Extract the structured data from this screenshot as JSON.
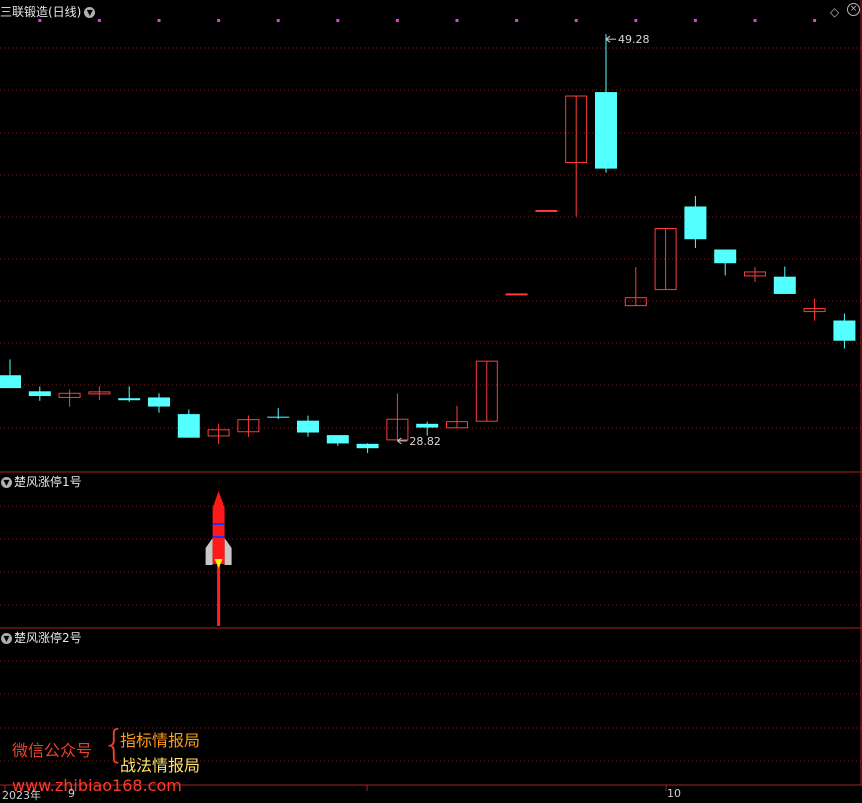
{
  "header": {
    "title": "三联锻造(日线)",
    "sub_panel_1_title": "楚风涨停1号",
    "sub_panel_2_title": "楚风涨停2号"
  },
  "colors": {
    "up": "#ff3c3c",
    "down": "#54ffff",
    "grid": "#8c1a1a",
    "marker": "#e040e0",
    "background": "#000000"
  },
  "icons": {
    "dropdown": "chevron-down-icon",
    "diamond": "diamond-icon",
    "close": "close-icon"
  },
  "chart_data": [
    {
      "type": "candlestick",
      "title": "三联锻造(日线)",
      "ylim": [
        27.2,
        50.6
      ],
      "grid": true,
      "annotations": [
        {
          "label": "49.28",
          "value": 49.28,
          "type": "high"
        },
        {
          "label": "28.82",
          "value": 28.82,
          "type": "low"
        }
      ],
      "candles": [
        {
          "open": 32.08,
          "close": 31.43,
          "high": 32.88,
          "low": 31.43
        },
        {
          "open": 31.27,
          "close": 31.03,
          "high": 31.51,
          "low": 30.79
        },
        {
          "open": 30.96,
          "close": 31.17,
          "high": 31.36,
          "low": 30.49
        },
        {
          "open": 31.14,
          "close": 31.24,
          "high": 31.52,
          "low": 30.83
        },
        {
          "open": 30.92,
          "close": 30.82,
          "high": 31.52,
          "low": 30.74
        },
        {
          "open": 30.96,
          "close": 30.5,
          "high": 31.17,
          "low": 30.19
        },
        {
          "open": 30.12,
          "close": 28.93,
          "high": 30.35,
          "low": 28.93
        },
        {
          "open": 29.02,
          "close": 29.33,
          "high": 29.64,
          "low": 28.61
        },
        {
          "open": 29.23,
          "close": 29.84,
          "high": 30.05,
          "low": 28.96
        },
        {
          "open": 29.99,
          "close": 29.96,
          "high": 30.42,
          "low": 29.87
        },
        {
          "open": 29.79,
          "close": 29.19,
          "high": 30.04,
          "low": 28.98
        },
        {
          "open": 29.06,
          "close": 28.64,
          "high": 29.07,
          "low": 28.52
        },
        {
          "open": 28.62,
          "close": 28.4,
          "high": 28.65,
          "low": 28.16
        },
        {
          "open": 28.82,
          "close": 29.86,
          "high": 31.16,
          "low": 28.82
        },
        {
          "open": 29.63,
          "close": 29.44,
          "high": 29.74,
          "low": 29.03
        },
        {
          "open": 29.43,
          "close": 29.74,
          "high": 30.55,
          "low": 29.43
        },
        {
          "open": 29.76,
          "close": 32.79,
          "high": 32.79,
          "low": 29.76
        },
        {
          "open": 36.18,
          "close": 36.18,
          "high": 36.18,
          "low": 36.18
        },
        {
          "open": 40.39,
          "close": 40.39,
          "high": 40.39,
          "low": 40.39
        },
        {
          "open": 42.81,
          "close": 46.16,
          "high": 46.16,
          "low": 40.09
        },
        {
          "open": 46.36,
          "close": 42.5,
          "high": 49.28,
          "low": 42.3
        },
        {
          "open": 35.59,
          "close": 35.99,
          "high": 37.53,
          "low": 35.59
        },
        {
          "open": 36.4,
          "close": 39.48,
          "high": 39.48,
          "low": 36.4
        },
        {
          "open": 40.59,
          "close": 38.94,
          "high": 41.12,
          "low": 38.5
        },
        {
          "open": 38.42,
          "close": 37.73,
          "high": 38.42,
          "low": 37.12
        },
        {
          "open": 37.09,
          "close": 37.29,
          "high": 37.54,
          "low": 36.78
        },
        {
          "open": 37.05,
          "close": 36.18,
          "high": 37.56,
          "low": 36.18
        },
        {
          "open": 35.29,
          "close": 35.45,
          "high": 35.95,
          "low": 34.83
        },
        {
          "open": 34.84,
          "close": 33.82,
          "high": 35.19,
          "low": 33.43
        }
      ]
    },
    {
      "type": "signal",
      "title": "楚风涨停1号",
      "signals": [
        {
          "bar_index": 7,
          "symbol": "rocket"
        }
      ]
    },
    {
      "type": "signal",
      "title": "楚风涨停2号",
      "signals": []
    }
  ],
  "xaxis": {
    "labels": [
      "2023年",
      "9",
      "10"
    ]
  },
  "watermark": {
    "wechat_label": "微信公众号",
    "brace": "{",
    "line1": "指标情报局",
    "line2": "战法情报局",
    "url": "www.zhibiao168.com"
  }
}
